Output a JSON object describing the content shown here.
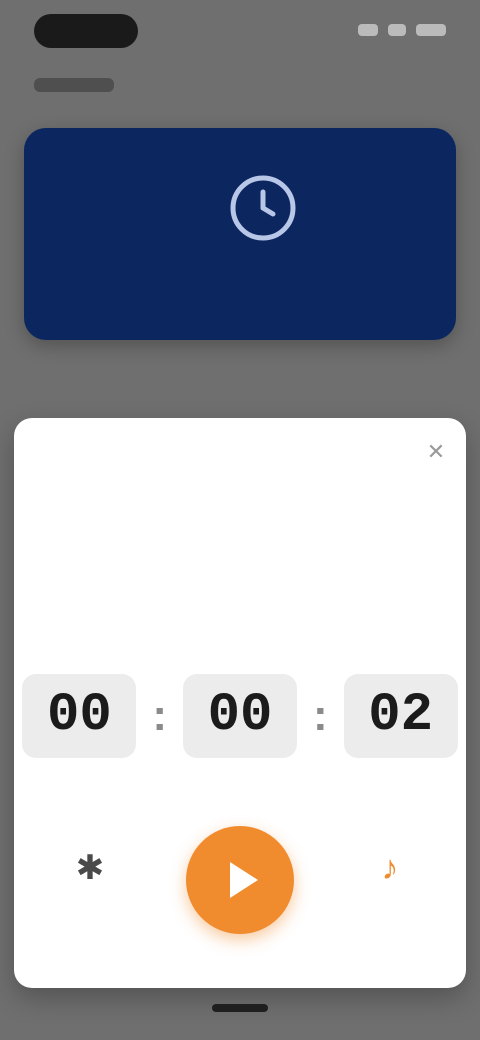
{
  "status": {},
  "header": {
    "title": ""
  },
  "card": {
    "icon": "clock-icon",
    "label": ""
  },
  "sheet": {
    "title": "",
    "close_icon": "close-icon",
    "promo_text": "",
    "mode_label": "",
    "time": {
      "hours": "00",
      "minutes": "00",
      "seconds": "02"
    },
    "caption": "",
    "controls": {
      "left_icon": "more-icon",
      "left_label": "",
      "start_icon": "play-icon",
      "right_icon": "sound-icon",
      "right_label": ""
    }
  },
  "colors": {
    "accent": "#f08c2e",
    "card_bg": "#0c2660"
  }
}
